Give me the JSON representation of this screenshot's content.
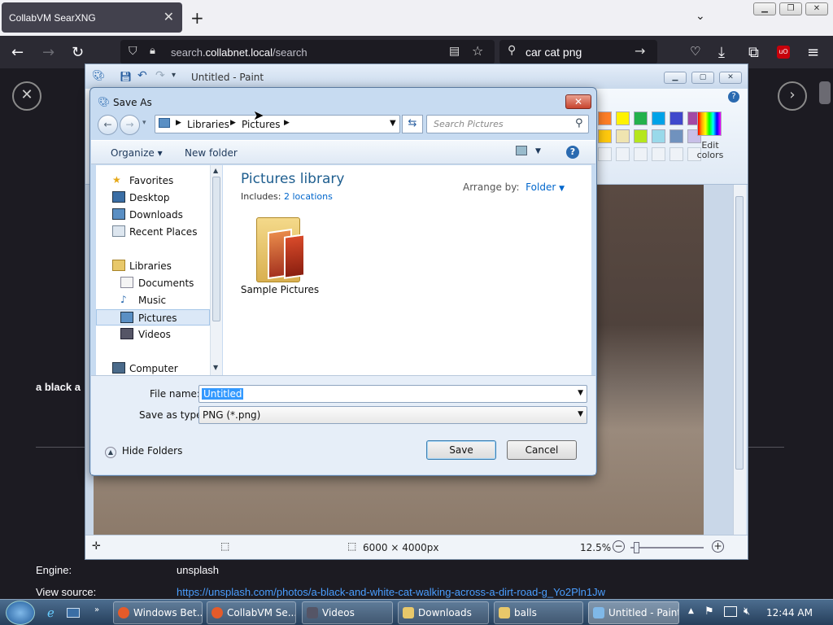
{
  "browser": {
    "tab_title": "CollabVM SearXNG",
    "tab_close": "✕",
    "new_tab": "+",
    "url_host": "search.",
    "url_domain": "collabnet.local",
    "url_path": "/search",
    "search_query": "car cat png"
  },
  "page": {
    "result_snippet": "a black a",
    "engine_label": "Engine:",
    "engine_value": "unsplash",
    "source_label": "View source:",
    "source_url": "https://unsplash.com/photos/a-black-and-white-cat-walking-across-a-dirt-road-g_Yo2Pln1Jw"
  },
  "paint": {
    "title": "Untitled - Paint",
    "edit_colors": "Edit colors",
    "image_size": "6000 × 4000px",
    "zoom": "12.5%",
    "palette": [
      "#ff7f27",
      "#fff200",
      "#22b14c",
      "#00a2e8",
      "#3f48cc",
      "#a349a4",
      "#ffc90e",
      "#efe4b0",
      "#b5e61d",
      "#99d9ea",
      "#7092be",
      "#c8bfe7"
    ]
  },
  "dialog": {
    "title": "Save As",
    "breadcrumb": [
      "Libraries",
      "Pictures"
    ],
    "search_placeholder": "Search Pictures",
    "organize": "Organize",
    "new_folder": "New folder",
    "nav": {
      "favorites": "Favorites",
      "desktop": "Desktop",
      "downloads": "Downloads",
      "recent": "Recent Places",
      "libraries": "Libraries",
      "documents": "Documents",
      "music": "Music",
      "pictures": "Pictures",
      "videos": "Videos",
      "computer": "Computer"
    },
    "library_title": "Pictures library",
    "includes_label": "Includes:",
    "includes_link": "2 locations",
    "arrange_label": "Arrange by:",
    "arrange_value": "Folder",
    "folder_name": "Sample Pictures",
    "file_name_label": "File name:",
    "file_name_value": "Untitled",
    "save_type_label": "Save as type:",
    "save_type_value": "PNG (*.png)",
    "hide_folders": "Hide Folders",
    "save": "Save",
    "cancel": "Cancel"
  },
  "taskbar": {
    "items": [
      "Windows Bet...",
      "CollabVM Se...",
      "Videos",
      "Downloads",
      "balls",
      "Untitled - Paint"
    ],
    "clock": "12:44 AM"
  }
}
